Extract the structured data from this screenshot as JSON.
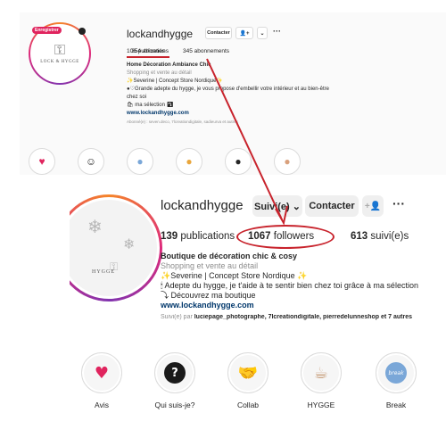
{
  "old_profile": {
    "badge": "Enregistrer",
    "logo_text": "LOCK & HYGGE",
    "username": "lockandhygge",
    "contact_label": "Contacter",
    "adduser_icon": "add-user-icon",
    "chevron_icon": "chevron-down-icon",
    "more_label": "···",
    "stats": {
      "publications": "106 publications",
      "followers": "354 abonnés",
      "following": "345 abonnements"
    },
    "bio": {
      "name": "Home Décoration Ambiance Chic",
      "category": "Shopping et vente au détail",
      "line1": "✨Severine | Concept Store Nordique✨",
      "line2": "●♡Grande adepte du hygge, je vous propose d'embellir votre intérieur et au bien-être",
      "line3": "chez soi",
      "line4": "🛍 ma sélection ⤵",
      "link": "www.lockandhygge.com",
      "suggested": "Abonné(e) : seven.deco, 7lcreationdigitale, sadieurva et autres"
    }
  },
  "profile": {
    "username": "lockandhygge",
    "follow_label": "Suivi(e) ⌄",
    "contact_label": "Contacter",
    "adduser_icon": "add-user-icon",
    "more_label": "···",
    "logo_text": "HYGGE",
    "stats": {
      "publications_count": "139",
      "publications_label": " publications",
      "followers_count": "1067",
      "followers_label": " followers",
      "following_count": "613",
      "following_label": " suivi(e)s"
    },
    "bio": {
      "name": "Boutique de décoration chic & cosy",
      "category": "Shopping et vente au détail",
      "line1": "✨Severine | Concept Store Nordique ✨",
      "line2": "🕯 Adepte du hygge, je t'aide à te sentir bien chez toi grâce à ma sélection",
      "line3": "⤵ Découvrez ma boutique",
      "link": "www.lockandhygge.com"
    },
    "suggested_prefix": "Suivi(e) par ",
    "suggested_names": "luciepage_photographe, 7lcreationdigitale, pierredelunnesh​op et 7 autres"
  },
  "highlights": [
    {
      "label": "Avis",
      "icon": "heart-icon"
    },
    {
      "label": "Qui suis-je?",
      "icon": "question-icon"
    },
    {
      "label": "Collab",
      "icon": "handshake-icon"
    },
    {
      "label": "HYGGE",
      "icon": "cup-icon"
    },
    {
      "label": "Break",
      "icon": "break-icon"
    }
  ],
  "colors": {
    "annotation_red": "#c8232c",
    "link_blue": "#00376b",
    "muted_gray": "#8e8e8e"
  }
}
